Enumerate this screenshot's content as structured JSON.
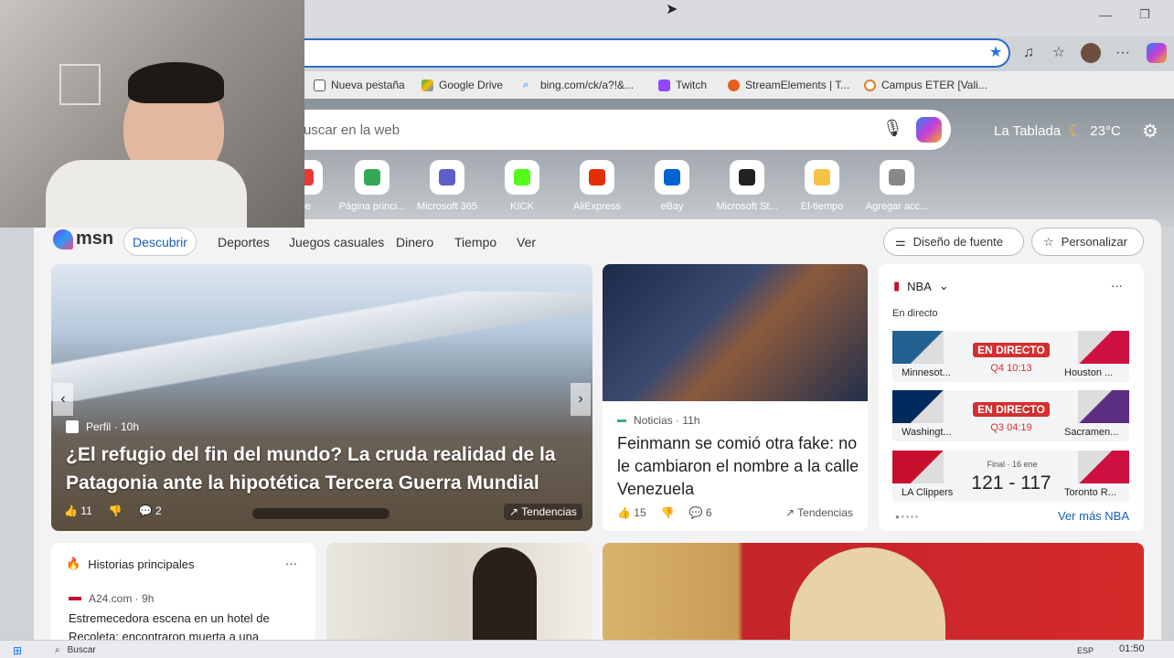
{
  "browser": {
    "favorites": [
      "Nueva pestaña",
      "Google Drive",
      "bing.com/ck/a?!&...",
      "Twitch",
      "StreamElements | T...",
      "Campus ETER [Vali..."
    ]
  },
  "hero": {
    "search_placeholder": "uscar en la web",
    "weather_city": "La Tablada",
    "weather_temp": "23°C",
    "tiles": [
      {
        "label": "be",
        "icon": "youtube-icon",
        "color": "#e53935"
      },
      {
        "label": "Página princi...",
        "icon": "google-drive-icon",
        "color": "#34a853"
      },
      {
        "label": "Microsoft 365",
        "icon": "microsoft-365-icon",
        "color": "#5b5fc7"
      },
      {
        "label": "KICK",
        "icon": "kick-icon",
        "color": "#53fc18"
      },
      {
        "label": "AliExpress",
        "icon": "aliexpress-icon",
        "color": "#e62e04"
      },
      {
        "label": "eBay",
        "icon": "ebay-icon",
        "color": "#0064d2"
      },
      {
        "label": "Microsoft St...",
        "icon": "microsoft-store-icon",
        "color": "#222"
      },
      {
        "label": "El-tiempo",
        "icon": "el-tiempo-icon",
        "color": "#f5c342"
      },
      {
        "label": "Agregar acc...",
        "icon": "plus-icon",
        "color": "#888"
      }
    ]
  },
  "msn": {
    "logo": "msn",
    "tabs": [
      "Descubrir",
      "Deportes",
      "Juegos casuales",
      "Dinero",
      "Tiempo",
      "Ver"
    ],
    "font_design": "Diseño de fuente",
    "personalize": "Personalizar"
  },
  "main_story": {
    "source": "Perfil · 10h",
    "title": "¿El refugio del fin del mundo? La cruda realidad de la Patagonia ante la hipotética Tercera Guerra Mundial",
    "likes": "11",
    "comments": "2",
    "trend": "Tendencias"
  },
  "second_story": {
    "source": "Noticias · 11h",
    "title": "Feinmann se comió otra fake: no le cambiaron el nombre a la calle Venezuela",
    "likes": "15",
    "comments": "6",
    "trend": "Tendencias"
  },
  "nba": {
    "league": "NBA",
    "live_label": "En directo",
    "games": [
      {
        "home": "Minnesot...",
        "away": "Houston ...",
        "status": "EN DIRECTO",
        "clock": "Q4 10:13"
      },
      {
        "home": "Washingt...",
        "away": "Sacramen...",
        "status": "EN DIRECTO",
        "clock": "Q3 04:19"
      },
      {
        "home": "LA Clippers",
        "away": "Toronto R...",
        "status": "Final · 16 ene",
        "score_home": "121",
        "score_away": "117"
      }
    ],
    "more": "Ver más NBA"
  },
  "top_stories": {
    "heading": "Historias principales",
    "source": "A24.com · 9h",
    "headline": "Estremecedora escena en un hotel de Recoleta: encontraron muerta a una"
  },
  "taskbar": {
    "search": "Buscar",
    "time": "01:50",
    "lang": "ESP"
  },
  "colors": {
    "accent": "#2b6cc4",
    "live": "#d32f2f"
  }
}
